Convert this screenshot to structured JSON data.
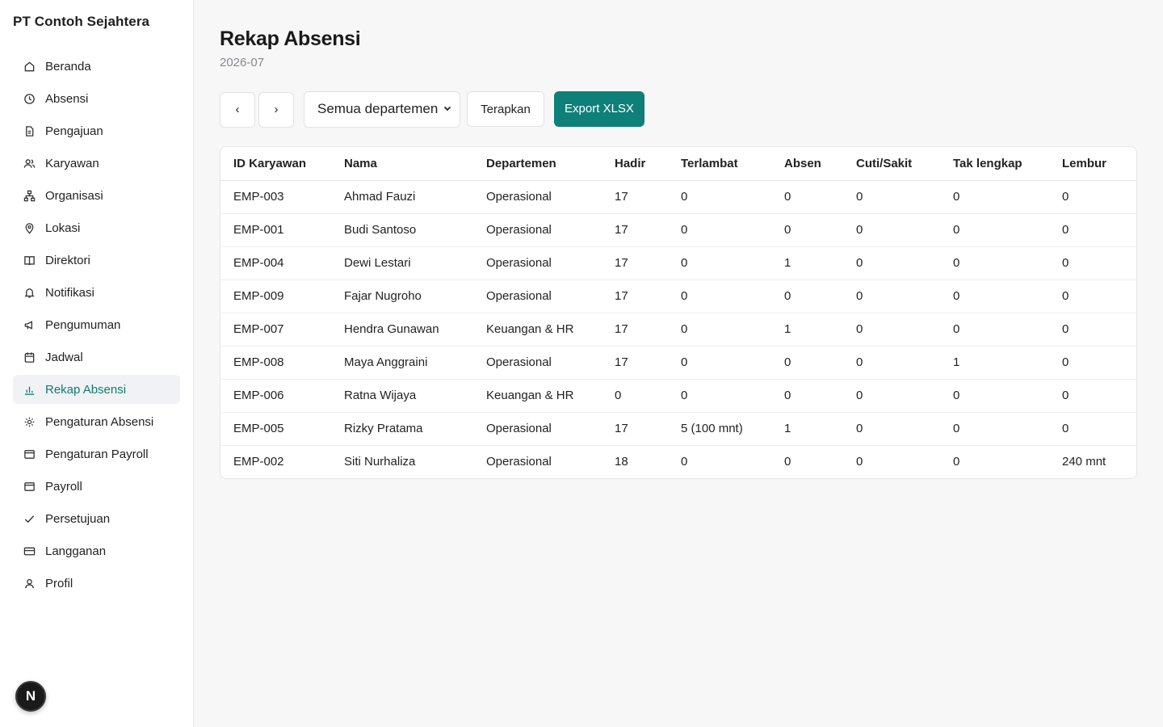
{
  "company_name": "PT Contoh Sejahtera",
  "sidebar": {
    "items": [
      {
        "label": "Beranda",
        "icon": "home-icon"
      },
      {
        "label": "Absensi",
        "icon": "clock-icon"
      },
      {
        "label": "Pengajuan",
        "icon": "document-icon"
      },
      {
        "label": "Karyawan",
        "icon": "users-icon"
      },
      {
        "label": "Organisasi",
        "icon": "org-chart-icon"
      },
      {
        "label": "Lokasi",
        "icon": "location-pin-icon"
      },
      {
        "label": "Direktori",
        "icon": "book-icon"
      },
      {
        "label": "Notifikasi",
        "icon": "bell-icon"
      },
      {
        "label": "Pengumuman",
        "icon": "megaphone-icon"
      },
      {
        "label": "Jadwal",
        "icon": "calendar-icon"
      },
      {
        "label": "Rekap Absensi",
        "icon": "bar-chart-icon",
        "active": true
      },
      {
        "label": "Pengaturan Absensi",
        "icon": "gear-icon"
      },
      {
        "label": "Pengaturan Payroll",
        "icon": "wallet-icon"
      },
      {
        "label": "Payroll",
        "icon": "wallet-icon"
      },
      {
        "label": "Persetujuan",
        "icon": "check-icon"
      },
      {
        "label": "Langganan",
        "icon": "credit-card-icon"
      },
      {
        "label": "Profil",
        "icon": "user-icon"
      }
    ]
  },
  "avatar_letter": "N",
  "page": {
    "title": "Rekap Absensi",
    "period": "2026-07"
  },
  "toolbar": {
    "prev_label": "‹",
    "next_label": "›",
    "department_select": "Semua departemen",
    "apply_label": "Terapkan",
    "export_label": "Export XLSX"
  },
  "colors": {
    "accent": "#0f7f7a",
    "active_nav_text": "#0f7c74"
  },
  "table": {
    "columns": [
      "ID Karyawan",
      "Nama",
      "Departemen",
      "Hadir",
      "Terlambat",
      "Absen",
      "Cuti/Sakit",
      "Tak lengkap",
      "Lembur"
    ],
    "rows": [
      [
        "EMP-003",
        "Ahmad Fauzi",
        "Operasional",
        "17",
        "0",
        "0",
        "0",
        "0",
        "0"
      ],
      [
        "EMP-001",
        "Budi Santoso",
        "Operasional",
        "17",
        "0",
        "0",
        "0",
        "0",
        "0"
      ],
      [
        "EMP-004",
        "Dewi Lestari",
        "Operasional",
        "17",
        "0",
        "1",
        "0",
        "0",
        "0"
      ],
      [
        "EMP-009",
        "Fajar Nugroho",
        "Operasional",
        "17",
        "0",
        "0",
        "0",
        "0",
        "0"
      ],
      [
        "EMP-007",
        "Hendra Gunawan",
        "Keuangan & HR",
        "17",
        "0",
        "1",
        "0",
        "0",
        "0"
      ],
      [
        "EMP-008",
        "Maya Anggraini",
        "Operasional",
        "17",
        "0",
        "0",
        "0",
        "1",
        "0"
      ],
      [
        "EMP-006",
        "Ratna Wijaya",
        "Keuangan & HR",
        "0",
        "0",
        "0",
        "0",
        "0",
        "0"
      ],
      [
        "EMP-005",
        "Rizky Pratama",
        "Operasional",
        "17",
        "5 (100 mnt)",
        "1",
        "0",
        "0",
        "0"
      ],
      [
        "EMP-002",
        "Siti Nurhaliza",
        "Operasional",
        "18",
        "0",
        "0",
        "0",
        "0",
        "240 mnt"
      ]
    ]
  }
}
